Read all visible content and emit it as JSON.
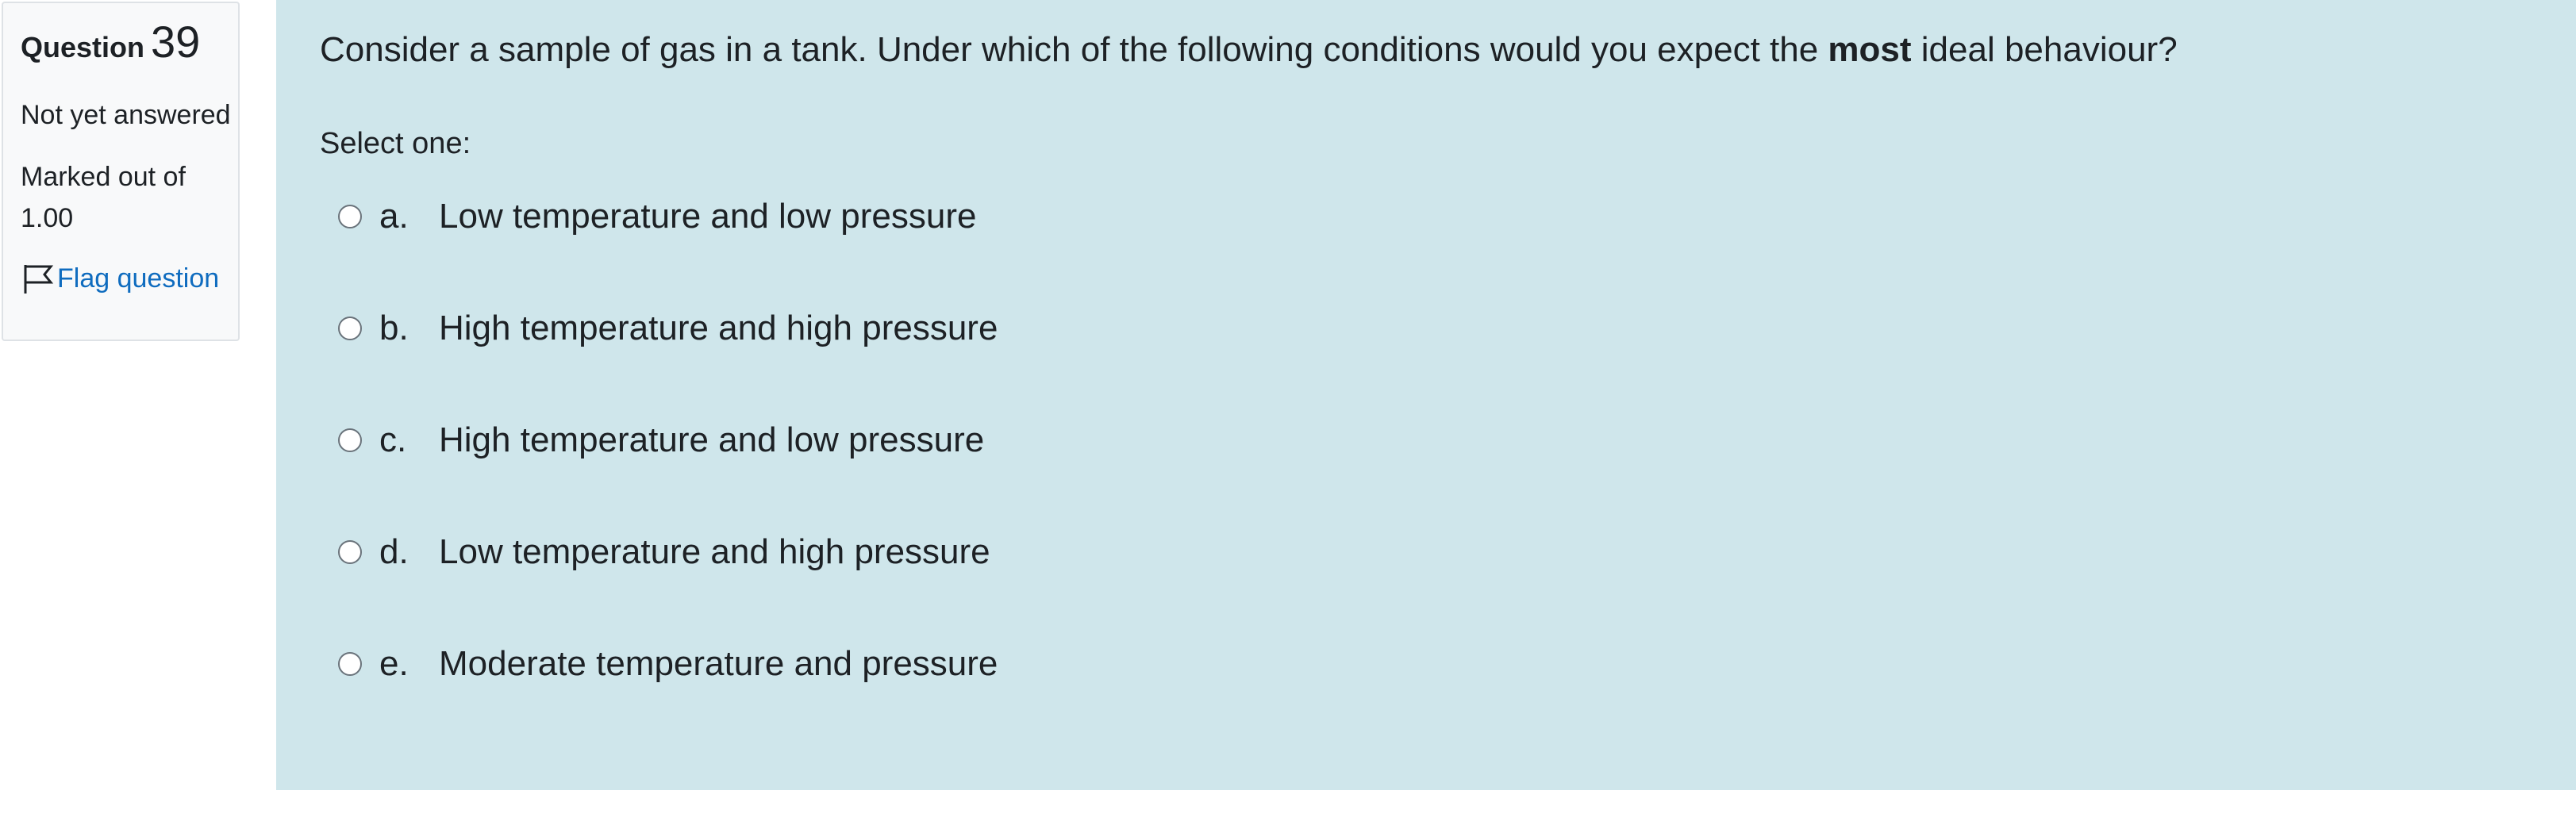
{
  "question_info": {
    "label": "Question",
    "number": "39",
    "state": "Not yet answered",
    "grade": "Marked out of 1.00",
    "flag_label": "Flag question",
    "flag_icon": "flag-icon"
  },
  "question": {
    "text_before": "Consider a sample of gas in a tank. Under which of the following conditions would you expect the ",
    "text_bold": "most",
    "text_after": " ideal behaviour?",
    "prompt": "Select one:",
    "answers": [
      {
        "letter": "a.",
        "text": "Low temperature and low pressure"
      },
      {
        "letter": "b.",
        "text": "High temperature and high pressure"
      },
      {
        "letter": "c.",
        "text": "High temperature and low pressure"
      },
      {
        "letter": "d.",
        "text": "Low temperature and high pressure"
      },
      {
        "letter": "e.",
        "text": "Moderate temperature and pressure"
      }
    ]
  },
  "colors": {
    "panel_background": "#cfe6eb",
    "info_background": "#f8f9fa",
    "link": "#0f6cbf",
    "text": "#1d2125"
  }
}
